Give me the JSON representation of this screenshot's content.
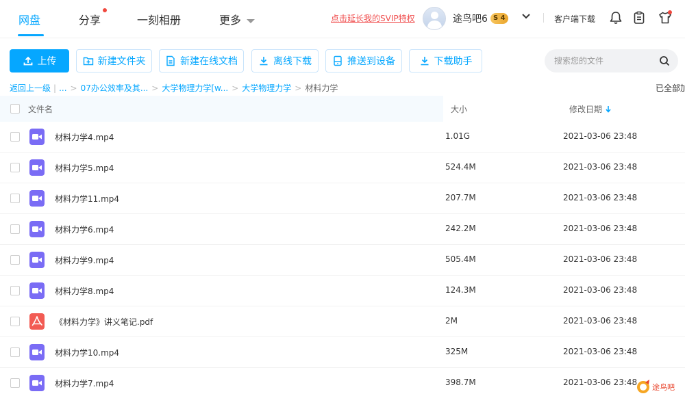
{
  "nav": {
    "items": [
      {
        "label": "网盘",
        "active": true
      },
      {
        "label": "分享",
        "dot": true
      },
      {
        "label": "一刻相册"
      },
      {
        "label": "更多"
      }
    ],
    "svip_link": "点击延长我的SVIP特权",
    "username": "途鸟吧6",
    "vip_badge": "S 4",
    "client_download": "客户端下载",
    "icons": [
      "bell-icon",
      "clipboard-icon",
      "tshirt-icon"
    ]
  },
  "toolbar": {
    "upload": "上传",
    "new_folder": "新建文件夹",
    "new_doc": "新建在线文档",
    "offline_download": "离线下载",
    "push_device": "推送到设备",
    "download_helper": "下载助手",
    "search_placeholder": "搜索您的文件"
  },
  "breadcrumb": {
    "back": "返回上一级",
    "ellipsis": "...",
    "items": [
      "07办公效率及其...",
      "大学物理力学[w...",
      "大学物理力学"
    ],
    "current": "材料力学",
    "loaded_text": "已全部加载"
  },
  "table": {
    "headers": {
      "name": "文件名",
      "size": "大小",
      "date": "修改日期"
    },
    "rows": [
      {
        "name": "材料力学4.mp4",
        "size": "1.01G",
        "date": "2021-03-06 23:48",
        "type": "video"
      },
      {
        "name": "材料力学5.mp4",
        "size": "524.4M",
        "date": "2021-03-06 23:48",
        "type": "video"
      },
      {
        "name": "材料力学11.mp4",
        "size": "207.7M",
        "date": "2021-03-06 23:48",
        "type": "video"
      },
      {
        "name": "材料力学6.mp4",
        "size": "242.2M",
        "date": "2021-03-06 23:48",
        "type": "video"
      },
      {
        "name": "材料力学9.mp4",
        "size": "505.4M",
        "date": "2021-03-06 23:48",
        "type": "video"
      },
      {
        "name": "材料力学8.mp4",
        "size": "124.3M",
        "date": "2021-03-06 23:48",
        "type": "video"
      },
      {
        "name": "《材料力学》讲义笔记.pdf",
        "size": "2M",
        "date": "2021-03-06 23:48",
        "type": "pdf"
      },
      {
        "name": "材料力学10.mp4",
        "size": "325M",
        "date": "2021-03-06 23:48",
        "type": "video"
      },
      {
        "name": "材料力学7.mp4",
        "size": "398.7M",
        "date": "2021-03-06 23:48",
        "type": "video"
      }
    ]
  },
  "watermark": "途鸟吧",
  "colors": {
    "accent": "#06a7ff",
    "video_icon": "#7a6cf5",
    "pdf_icon": "#f25b53",
    "svip_red": "#f04e4e"
  }
}
